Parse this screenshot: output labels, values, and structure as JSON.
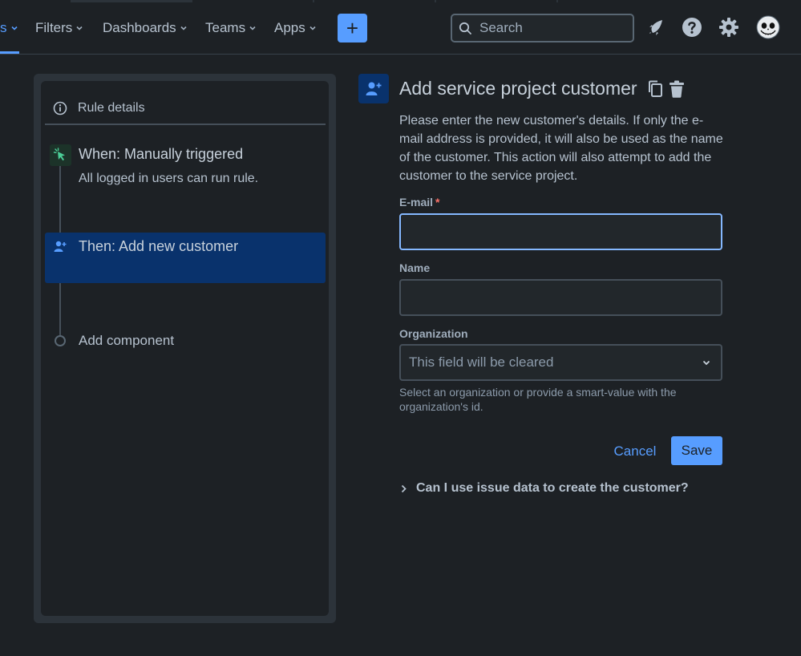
{
  "colors": {
    "background": "#1d2125",
    "accent": "#579dff",
    "selected_step": "#09326c",
    "trigger_green": "#4bce97",
    "required": "#f87168"
  },
  "nav": {
    "partial_item": "s",
    "items": [
      {
        "label": "Filters"
      },
      {
        "label": "Dashboards"
      },
      {
        "label": "Teams"
      },
      {
        "label": "Apps"
      }
    ],
    "create_label": "+",
    "search_placeholder": "Search",
    "icons": [
      "notifications-icon",
      "help-icon",
      "settings-icon",
      "avatar"
    ]
  },
  "rule": {
    "details_label": "Rule details",
    "trigger_title": "When: Manually triggered",
    "trigger_subtitle": "All logged in users can run rule.",
    "action_title": "Then: Add new customer",
    "add_component_label": "Add component"
  },
  "action": {
    "title": "Add service project customer",
    "description": "Please enter the new customer's details. If only the e-mail address is provided, it will also be used as the name of the customer. This action will also attempt to add the customer to the service project.",
    "email_label": "E-mail",
    "email_required_mark": "*",
    "email_value": "",
    "name_label": "Name",
    "name_value": "",
    "organization_label": "Organization",
    "organization_value": "This field will be cleared",
    "organization_helper": "Select an organization or provide a smart-value with the organization's id.",
    "cancel_label": "Cancel",
    "save_label": "Save",
    "faq_label": "Can I use issue data to create the customer?"
  }
}
